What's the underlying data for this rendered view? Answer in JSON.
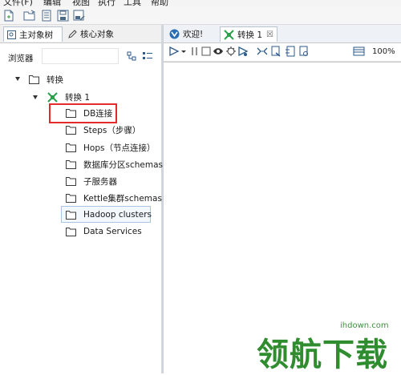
{
  "menubar": {
    "items": [
      "文件(F)",
      "编辑",
      "视图",
      "执行",
      "工具",
      "帮助"
    ]
  },
  "left_panel": {
    "tabs": [
      {
        "label": "主对象树",
        "icon": "tree-icon",
        "active": true
      },
      {
        "label": "核心对象",
        "icon": "pencil-icon",
        "active": false
      }
    ],
    "browser_label": "浏览器",
    "browser_placeholder": "",
    "tree": {
      "root_label": "转换",
      "transform_label": "转换 1",
      "children": [
        {
          "label": "DB连接"
        },
        {
          "label": "Steps（步骤）"
        },
        {
          "label": "Hops（节点连接）"
        },
        {
          "label": "数据库分区schemas"
        },
        {
          "label": "子服务器"
        },
        {
          "label": "Kettle集群schemas"
        },
        {
          "label": "Hadoop clusters"
        },
        {
          "label": "Data Services"
        }
      ]
    }
  },
  "right_panel": {
    "tabs": [
      {
        "label": "欢迎!",
        "icon": "welcome-icon",
        "active": false
      },
      {
        "label": "转换 1",
        "icon": "transform-icon",
        "active": true,
        "close": "☒"
      }
    ],
    "zoom": "100%"
  },
  "watermark": {
    "url": "ihdown.com",
    "text": "领航下载"
  },
  "colors": {
    "highlight": "#e32b2b",
    "transform_icon": "#2aa14a",
    "tree_border": "#cfd6e0",
    "logo": "#2f8d2f"
  }
}
